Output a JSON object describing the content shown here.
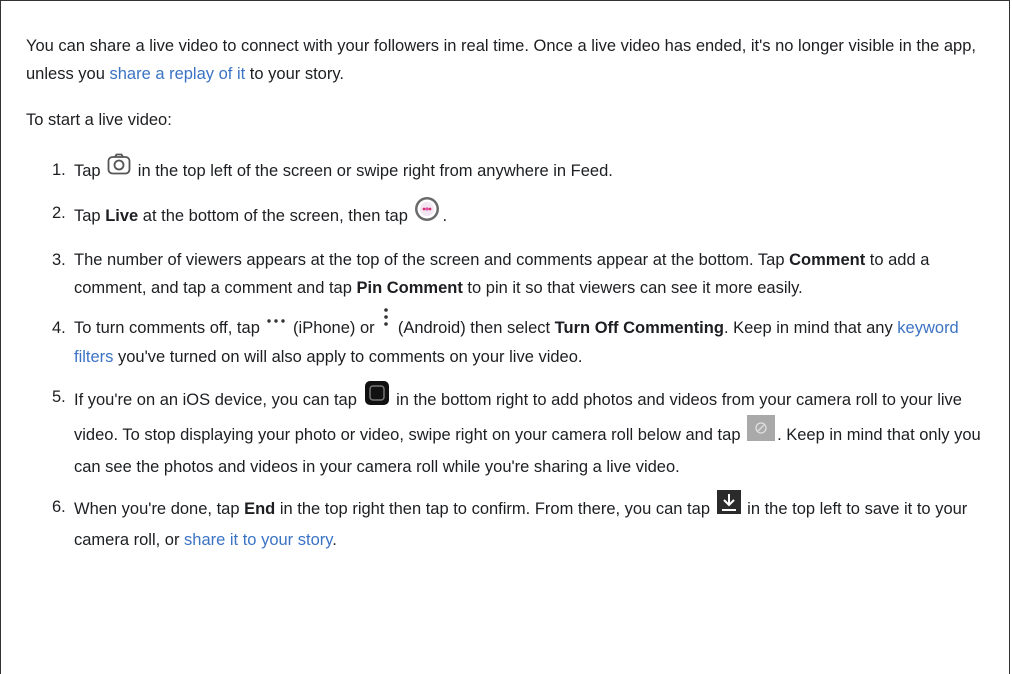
{
  "intro": {
    "text1": "You can share a live video to connect with your followers in real time. Once a live video has ended, it's no longer visible in the app, unless you ",
    "link": "share a replay of it",
    "text2": " to your story."
  },
  "start_heading": "To start a live video:",
  "colors": {
    "link": "#3b73c4",
    "text": "#1c1e21"
  },
  "steps": [
    {
      "num": "1.",
      "t1": "Tap ",
      "icon": "camera-icon",
      "t2": " in the top left of the screen or swipe right from anywhere in Feed."
    },
    {
      "num": "2.",
      "t1": "Tap ",
      "b1": "Live",
      "t2": " at the bottom of the screen, then tap ",
      "icon": "live-record-icon",
      "t3": "."
    },
    {
      "num": "3.",
      "t1": "The number of viewers appears at the top of the screen and comments appear at the bottom. Tap ",
      "b1": "Comment",
      "t2": " to add a comment, and tap a comment and tap ",
      "b2": "Pin Comment",
      "t3": " to pin it so that viewers can see it more easily."
    },
    {
      "num": "4.",
      "t1": "To turn comments off, tap ",
      "icon1": "more-horizontal-icon",
      "t2": " (iPhone) or ",
      "icon2": "more-vertical-icon",
      "t3": " (Android) then select ",
      "b1": "Turn Off Commenting",
      "t4": ". Keep in mind that any ",
      "link": "keyword filters",
      "t5": " you've turned on will also apply to comments on your live video."
    },
    {
      "num": "5.",
      "t1": "If you're on an iOS device, you can tap ",
      "icon1": "camera-roll-icon",
      "t2": " in the bottom right to add photos and videos from your camera roll to your live video. To stop displaying your photo or video, swipe right on your camera roll below and tap ",
      "icon2": "remove-media-icon",
      "t3": ". Keep in mind that only you can see the photos and videos in your camera roll while you're sharing a live video."
    },
    {
      "num": "6.",
      "t1": "When you're done, tap ",
      "b1": "End",
      "t2": " in the top right then tap to confirm. From there, you can tap ",
      "icon": "download-icon",
      "t3": " in the top left to save it to your camera roll, or ",
      "link": "share it to your story",
      "t4": "."
    }
  ]
}
